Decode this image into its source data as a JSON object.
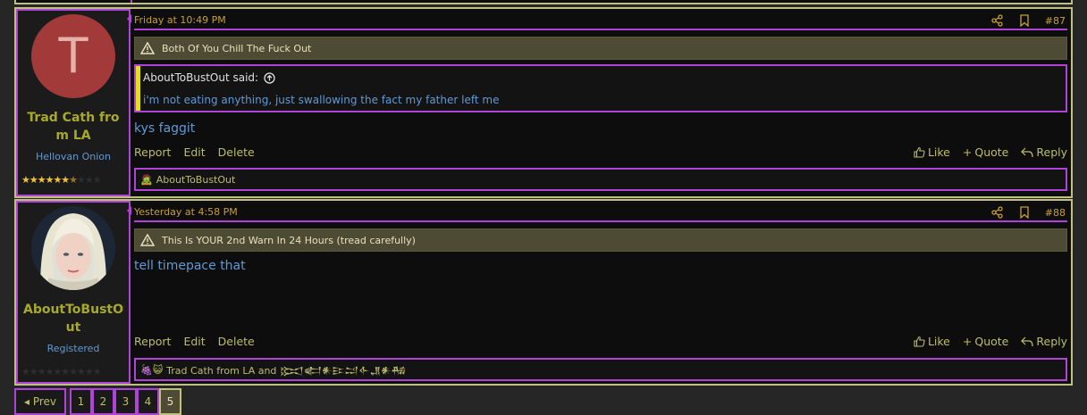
{
  "posts": [
    {
      "avatar_letter": "T",
      "username": "Trad Cath from LA",
      "user_title": "Hellovan Onion",
      "stars_filled": 6.5,
      "stars_total": 10,
      "date": "Friday at 10:49 PM",
      "post_number": "#87",
      "warning": "Both Of You Chill The Fuck Out",
      "quote": {
        "author": "AboutToBustOut said:",
        "text": "i'm not eating anything, just swallowing the fact my father left me"
      },
      "message": "kys faggit",
      "reactions_text": "AboutToBustOut"
    },
    {
      "username": "AboutToBustOut",
      "user_title": "Registered",
      "stars_filled": 0,
      "stars_total": 10,
      "date": "Yesterday at 4:58 PM",
      "post_number": "#88",
      "warning": "This Is YOUR 2nd Warn In 24 Hours (tread carefully)",
      "message": "tell timepace that",
      "reactions_text": "Trad Cath from LA and 𒁎𒅗𒀭𒄿𒁺𒅆𒂗𒀭𒄀"
    }
  ],
  "actions": {
    "report": "Report",
    "edit": "Edit",
    "delete": "Delete",
    "like": "Like",
    "quote": "Quote",
    "reply": "Reply"
  },
  "pagination": {
    "prev": "◂ Prev",
    "pages": [
      "1",
      "2",
      "3",
      "4",
      "5"
    ],
    "current": "5"
  },
  "colors": {
    "accent_border": "#b044d8",
    "post_border": "#c0c080",
    "link_blue": "#5f9ad6",
    "username": "#a8a82a",
    "date_orange": "#c8a030",
    "warning_bg": "#4d4b34"
  }
}
